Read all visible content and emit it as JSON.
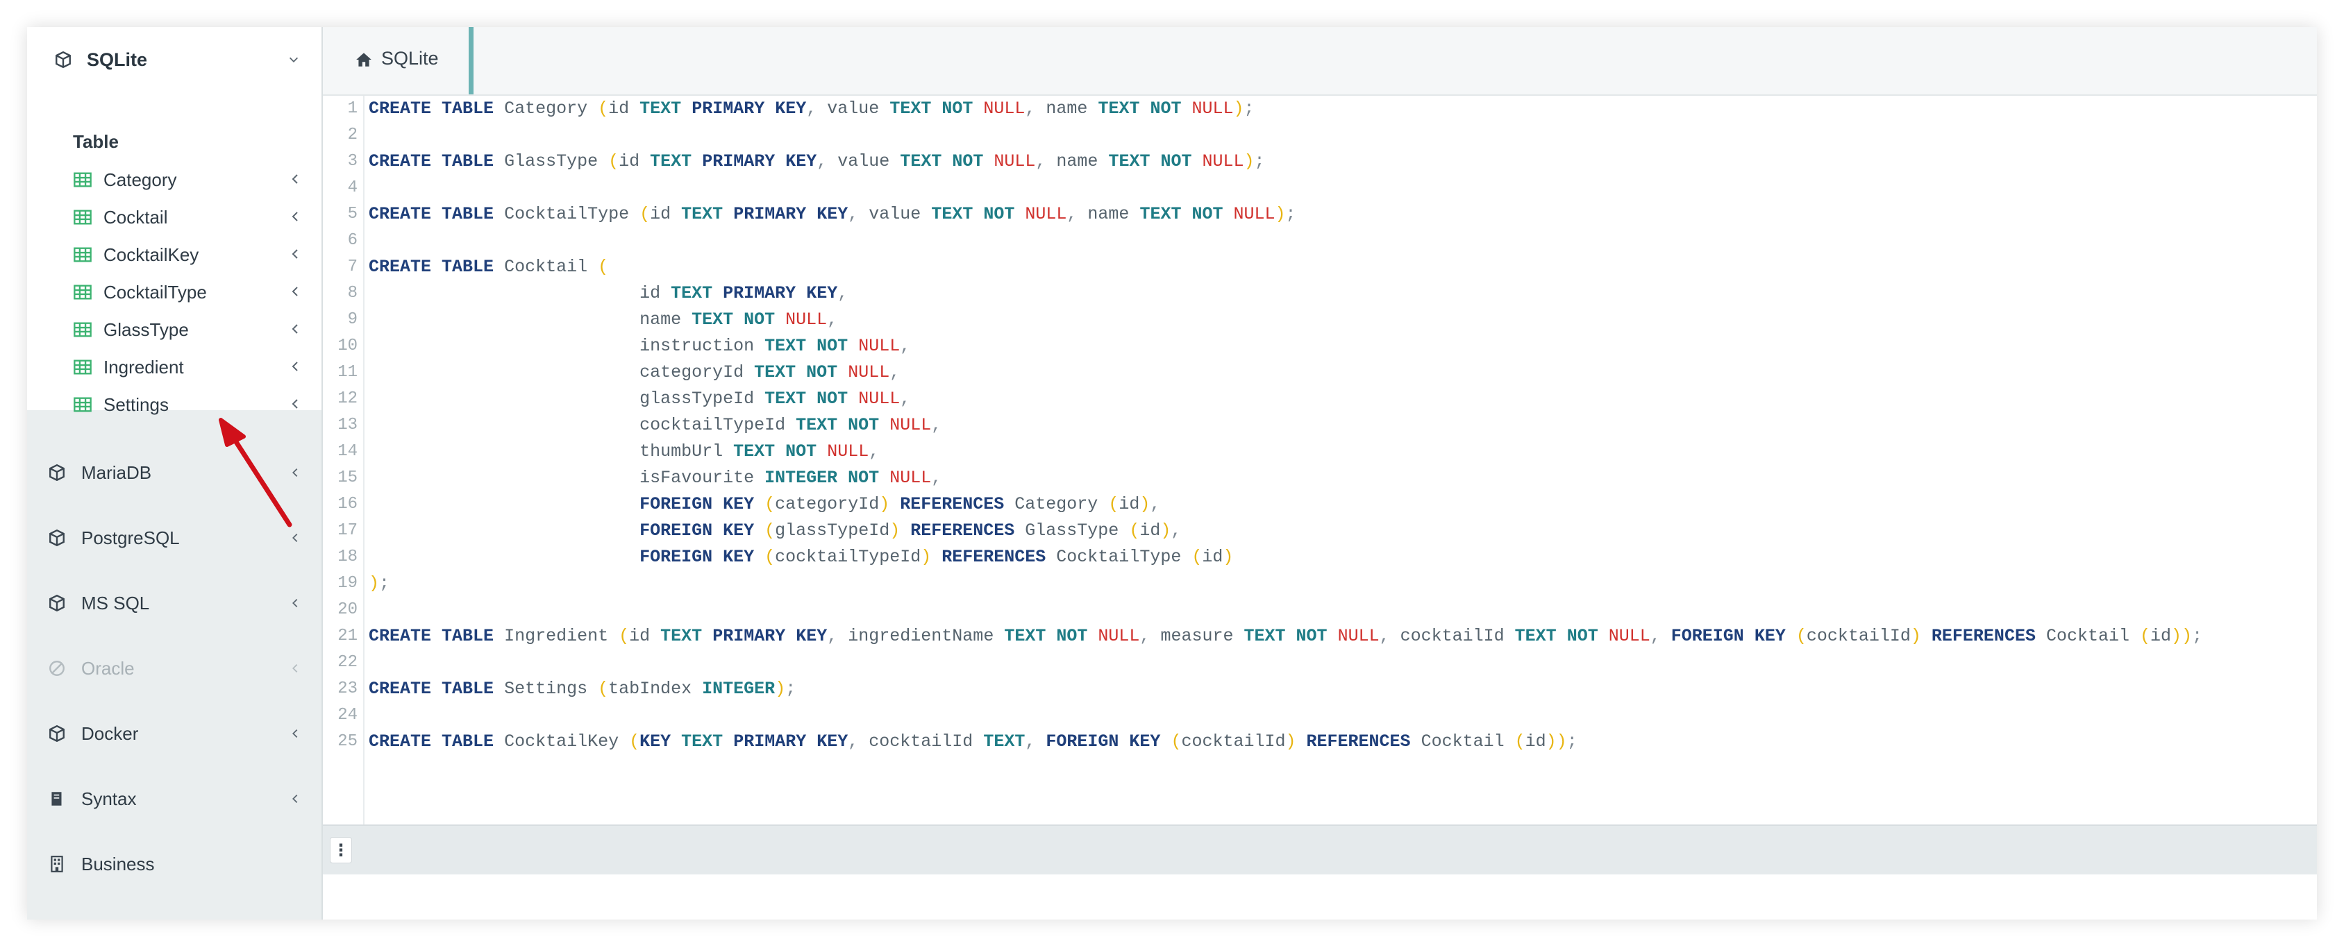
{
  "sidebar": {
    "active_db": {
      "label": "SQLite"
    },
    "section_title": "Table",
    "tables": [
      {
        "label": "Category"
      },
      {
        "label": "Cocktail"
      },
      {
        "label": "CocktailKey"
      },
      {
        "label": "CocktailType"
      },
      {
        "label": "GlassType"
      },
      {
        "label": "Ingredient"
      },
      {
        "label": "Settings"
      }
    ],
    "databases": [
      {
        "label": "MariaDB",
        "disabled": false
      },
      {
        "label": "PostgreSQL",
        "disabled": false
      },
      {
        "label": "MS SQL",
        "disabled": false
      },
      {
        "label": "Oracle",
        "disabled": true
      },
      {
        "label": "Docker",
        "disabled": false
      },
      {
        "label": "Syntax",
        "disabled": false
      },
      {
        "label": "Business",
        "disabled": false
      }
    ]
  },
  "tabs": [
    {
      "label": "SQLite",
      "icon": "home-icon"
    }
  ],
  "editor": {
    "line_numbers": [
      "1",
      "2",
      "3",
      "4",
      "5",
      "6",
      "7",
      "8",
      "9",
      "10",
      "11",
      "12",
      "13",
      "14",
      "15",
      "16",
      "17",
      "18",
      "19",
      "20",
      "21",
      "22",
      "23",
      "24",
      "25"
    ],
    "lines": [
      "CREATE TABLE Category (id TEXT PRIMARY KEY, value TEXT NOT NULL, name TEXT NOT NULL);",
      "",
      "CREATE TABLE GlassType (id TEXT PRIMARY KEY, value TEXT NOT NULL, name TEXT NOT NULL);",
      "",
      "CREATE TABLE CocktailType (id TEXT PRIMARY KEY, value TEXT NOT NULL, name TEXT NOT NULL);",
      "",
      "CREATE TABLE Cocktail (",
      "                          id TEXT PRIMARY KEY,",
      "                          name TEXT NOT NULL,",
      "                          instruction TEXT NOT NULL,",
      "                          categoryId TEXT NOT NULL,",
      "                          glassTypeId TEXT NOT NULL,",
      "                          cocktailTypeId TEXT NOT NULL,",
      "                          thumbUrl TEXT NOT NULL,",
      "                          isFavourite INTEGER NOT NULL,",
      "                          FOREIGN KEY (categoryId) REFERENCES Category (id),",
      "                          FOREIGN KEY (glassTypeId) REFERENCES GlassType (id),",
      "                          FOREIGN KEY (cocktailTypeId) REFERENCES CocktailType (id)",
      ");",
      "",
      "CREATE TABLE Ingredient (id TEXT PRIMARY KEY, ingredientName TEXT NOT NULL, measure TEXT NOT NULL, cocktailId TEXT NOT NULL, FOREIGN KEY (cocktailId) REFERENCES Cocktail (id));",
      "",
      "CREATE TABLE Settings (tabIndex INTEGER);",
      "",
      "CREATE TABLE CocktailKey (KEY TEXT PRIMARY KEY, cocktailId TEXT, FOREIGN KEY (cocktailId) REFERENCES Cocktail (id));"
    ]
  },
  "statusbar": {
    "menu_glyph": "⋮"
  },
  "colors": {
    "keyword": "#1f3f7a",
    "type": "#1f7c86",
    "null": "#d0312d",
    "paren": "#e8b512",
    "table_icon": "#3cb371",
    "tab_accent": "#6bb3b4",
    "arrow": "#d0101a"
  }
}
